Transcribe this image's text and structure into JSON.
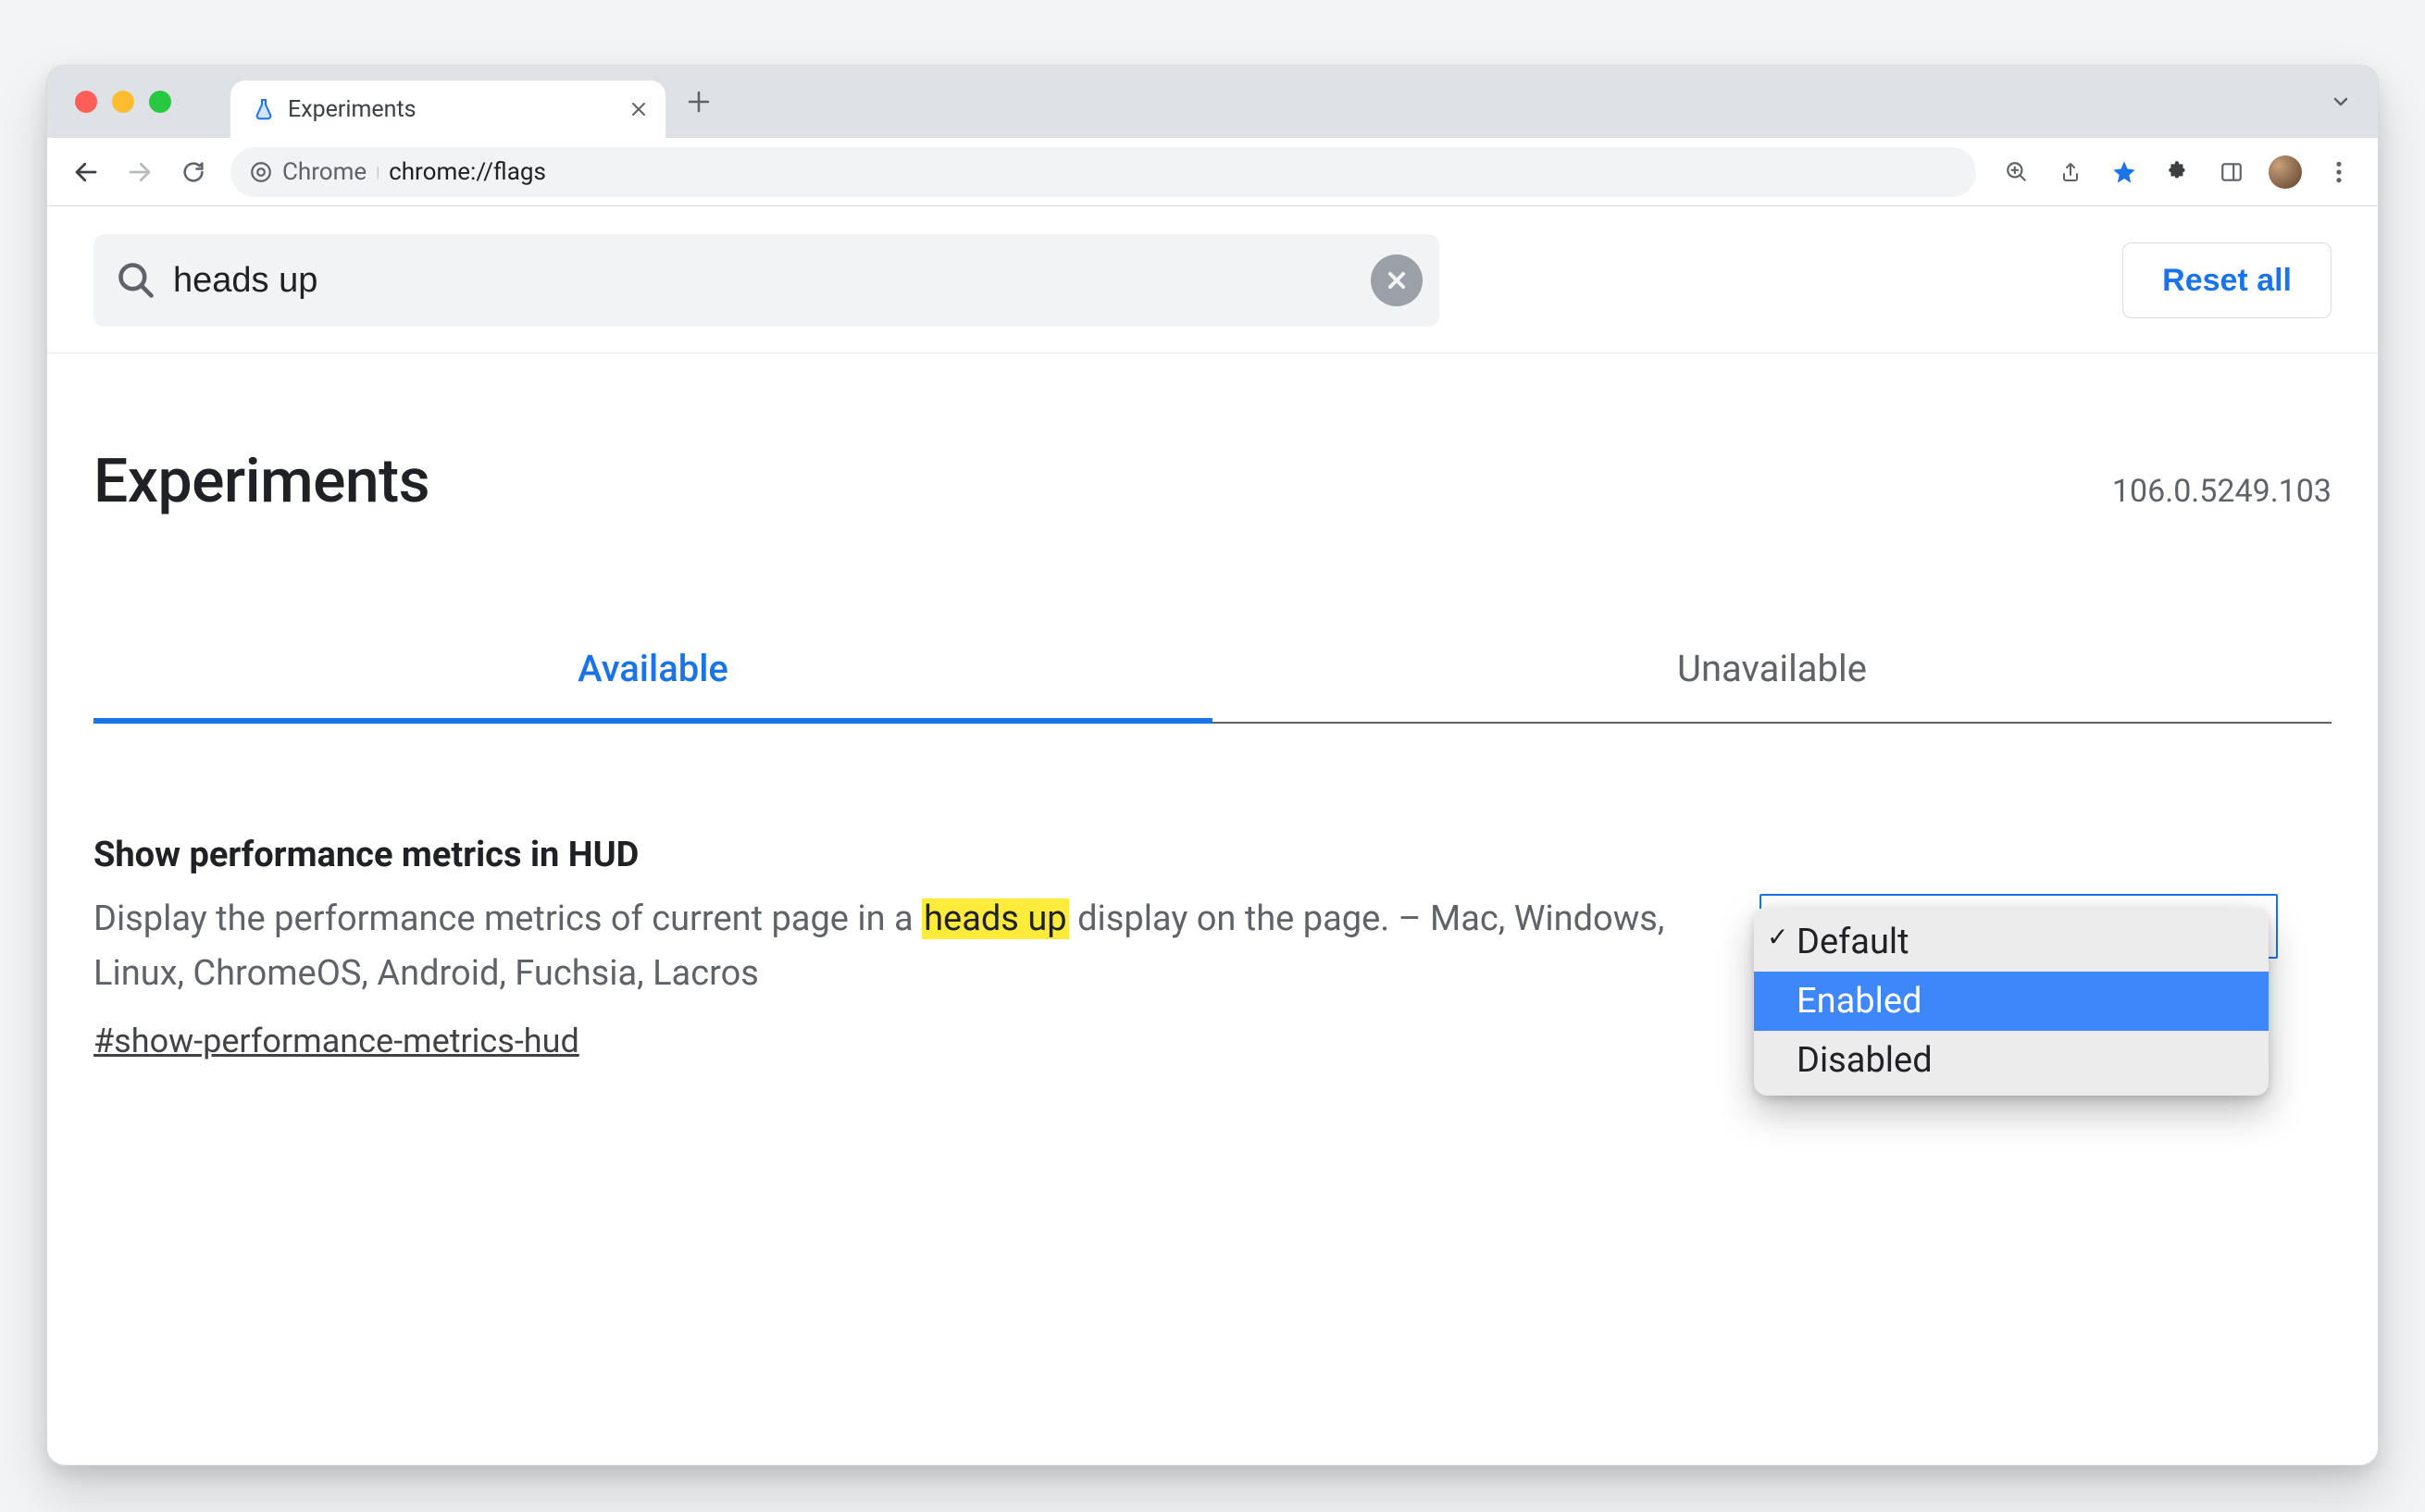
{
  "browser": {
    "tab_title": "Experiments",
    "omnibox_prefix": "Chrome",
    "omnibox_url": "chrome://flags"
  },
  "search": {
    "query": "heads up"
  },
  "reset_label": "Reset all",
  "page_title": "Experiments",
  "version": "106.0.5249.103",
  "tabs": {
    "available": "Available",
    "unavailable": "Unavailable"
  },
  "flag": {
    "title": "Show performance metrics in HUD",
    "desc_pre": "Display the performance metrics of current page in a ",
    "desc_highlight": "heads up",
    "desc_post": " display on the page. – Mac, Windows, Linux, ChromeOS, Android, Fuchsia, Lacros",
    "anchor": "#show-performance-metrics-hud",
    "options": {
      "default": "Default",
      "enabled": "Enabled",
      "disabled": "Disabled"
    }
  }
}
